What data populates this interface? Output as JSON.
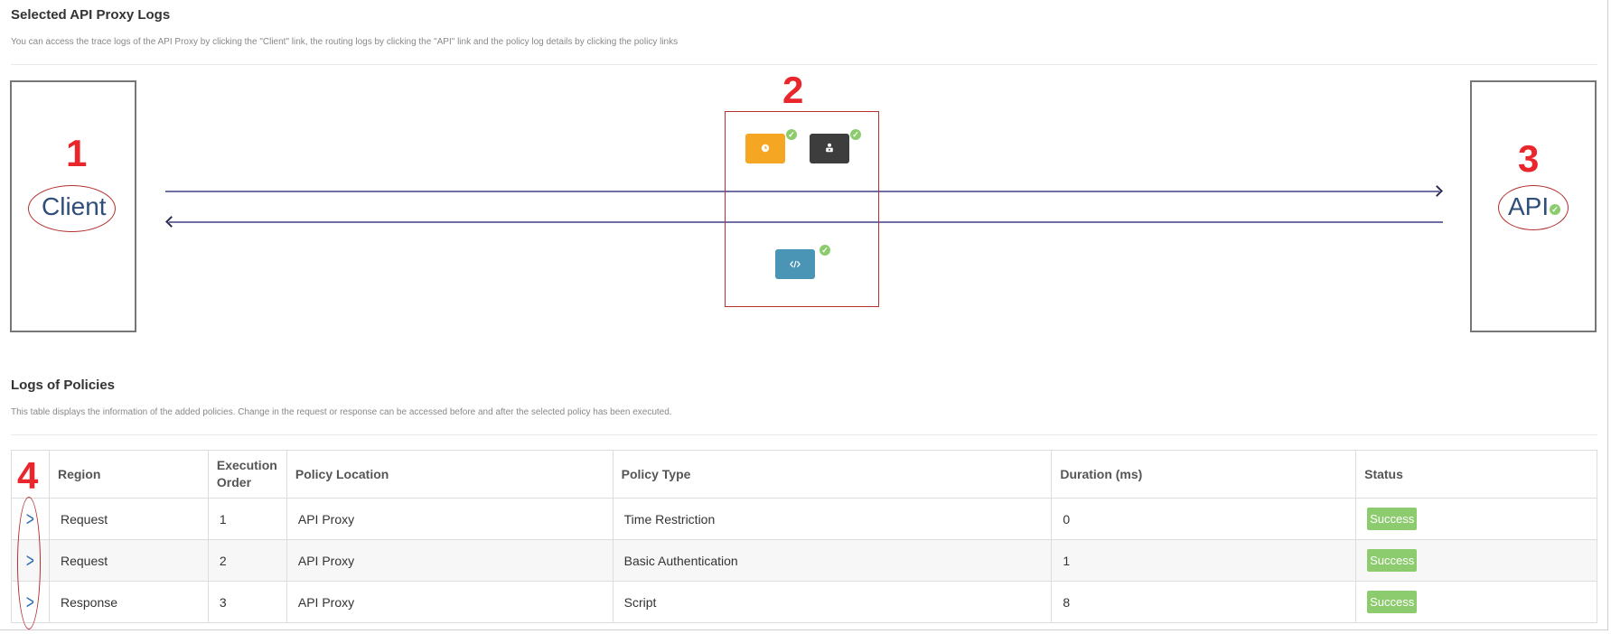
{
  "header": {
    "title": "Selected API Proxy Logs",
    "description": "You can access the trace logs of the API Proxy by clicking the \"Client\" link, the routing logs by clicking the \"API\" link and the policy log details by clicking the policy links"
  },
  "flow": {
    "client_label": "Client",
    "api_label": "API",
    "markers": [
      "1",
      "2",
      "3"
    ],
    "policies": [
      {
        "icon": "clock-icon",
        "color": "#f5a623"
      },
      {
        "icon": "user-lock-icon",
        "color": "#3d3d3d"
      },
      {
        "icon": "code-icon",
        "color": "#4a94b5"
      }
    ]
  },
  "policies_section": {
    "title": "Logs of Policies",
    "description": "This table displays the information of the added policies. Change in the request or response can be accessed before and after the selected policy has been executed.",
    "marker": "4"
  },
  "table": {
    "headers": {
      "region": "Region",
      "execution_order": "Execution Order",
      "policy_location": "Policy Location",
      "policy_type": "Policy Type",
      "duration": "Duration (ms)",
      "status": "Status"
    },
    "rows": [
      {
        "region": "Request",
        "order": "1",
        "location": "API Proxy",
        "type": "Time Restriction",
        "duration": "0",
        "status": "Success"
      },
      {
        "region": "Request",
        "order": "2",
        "location": "API Proxy",
        "type": "Basic Authentication",
        "duration": "1",
        "status": "Success"
      },
      {
        "region": "Response",
        "order": "3",
        "location": "API Proxy",
        "type": "Script",
        "duration": "8",
        "status": "Success"
      }
    ]
  },
  "colors": {
    "success": "#8dcc6e",
    "annotation_red": "#e8262b",
    "link_blue": "#2a6db0"
  }
}
